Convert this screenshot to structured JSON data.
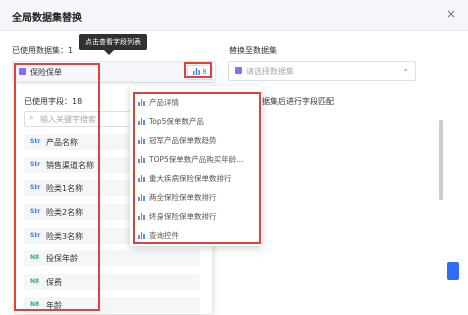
{
  "dialog": {
    "title": "全局数据集替换",
    "close": "×"
  },
  "used_datasets_label": "已使用数据集：1",
  "tooltip": "点击查看字段列表",
  "source": {
    "dataset_name": "保险保单",
    "field_count": "8",
    "chart_icon": "bar-chart-icon"
  },
  "target": {
    "label": "替换至数据集",
    "placeholder": "请选择数据集",
    "chevron": "⌄"
  },
  "background_text": "据集后进行字段匹配",
  "field_panel": {
    "title": "已使用字段：18",
    "search_placeholder": "输入关键字搜索",
    "fields": [
      {
        "type": "Str",
        "name": "产品名称"
      },
      {
        "type": "Str",
        "name": "销售渠道名称"
      },
      {
        "type": "Str",
        "name": "险类1名称"
      },
      {
        "type": "Str",
        "name": "险类2名称"
      },
      {
        "type": "Str",
        "name": "险类3名称"
      },
      {
        "type": "N8",
        "name": "投保年龄"
      },
      {
        "type": "N8",
        "name": "保费"
      },
      {
        "type": "N8",
        "name": "年龄"
      }
    ]
  },
  "chart_panel": {
    "items": [
      "产品详情",
      "Top5保单数产品",
      "冠军产品保单数趋势",
      "TOP5保单数产品购买年龄...",
      "重大疾病保险保单数排行",
      "两全保险保单数排行",
      "终身保险保单数排行",
      "查询控件"
    ]
  },
  "colors": {
    "accent": "#2f6df6",
    "highlight_border": "#e0413c",
    "dataset_icon": "#8b6cf0",
    "str_type": "#3a7bf7",
    "num_type": "#2bb56a"
  }
}
